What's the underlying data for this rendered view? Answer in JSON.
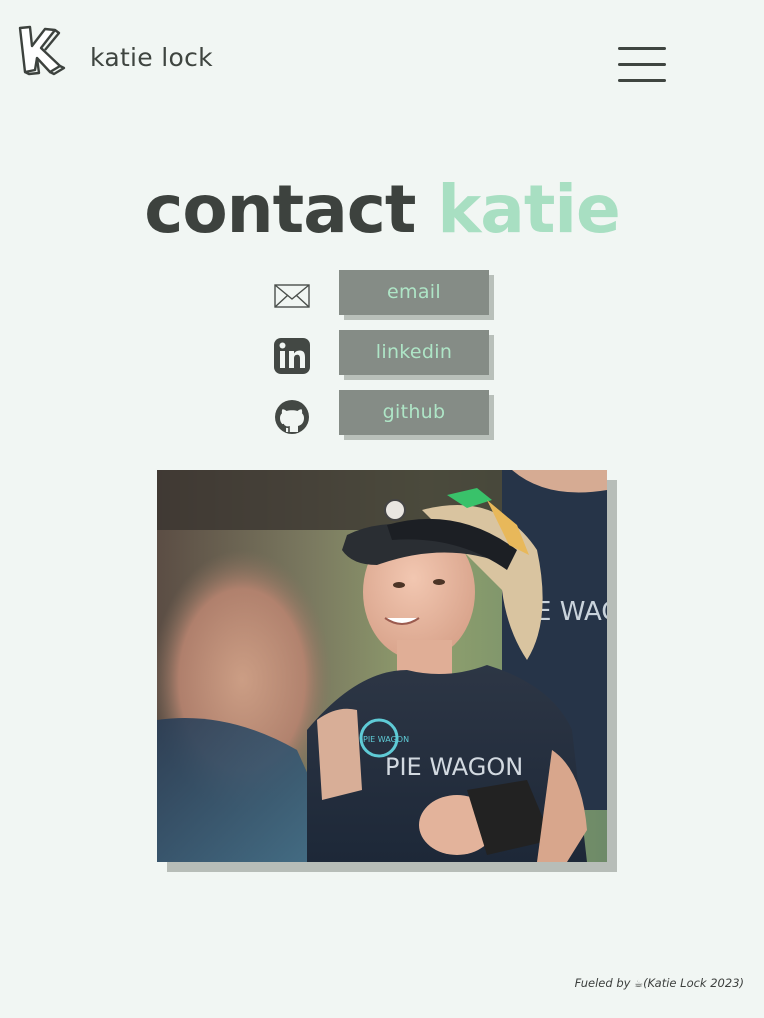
{
  "header": {
    "site_name": "katie lock",
    "logo_icon": "k-logo-icon",
    "menu_icon": "hamburger-menu-icon"
  },
  "heading": {
    "part1": "contact",
    "part2": "katie"
  },
  "contact_links": [
    {
      "label": "email",
      "icon": "envelope-icon"
    },
    {
      "label": "linkedin",
      "icon": "linkedin-icon"
    },
    {
      "label": "github",
      "icon": "github-icon"
    }
  ],
  "photo": {
    "shirt_text": "PIE WAGON",
    "badge_text": "PIE WAGON"
  },
  "footer": {
    "prefix": "Fueled by",
    "icon": "coffee-icon",
    "coffee_glyph": "☕",
    "text": "(Katie Lock 2023)"
  },
  "colors": {
    "background": "#f1f6f3",
    "accent": "#a8dfc2",
    "dark": "#3d423e",
    "button": "#858c86"
  }
}
